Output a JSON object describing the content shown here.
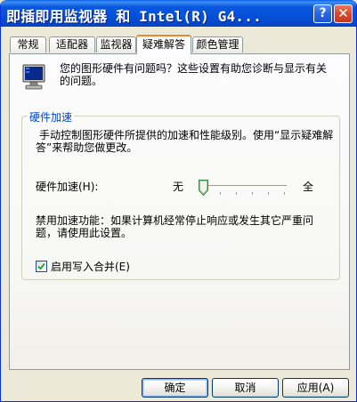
{
  "window": {
    "title": "即插即用监视器 和 Intel(R) G4..."
  },
  "titlebar": {
    "help_glyph": "?",
    "close_glyph": "✕"
  },
  "tabs": [
    {
      "label": "常规"
    },
    {
      "label": "适配器"
    },
    {
      "label": "监视器"
    },
    {
      "label": "疑难解答",
      "active": true
    },
    {
      "label": "颜色管理"
    }
  ],
  "intro": {
    "line1": "您的图形硬件有问题吗？这些设置有助您诊断与显示有关",
    "line2": "的问题。"
  },
  "hardware_acceleration": {
    "group_title": "硬件加速",
    "description_line1": "手动控制图形硬件所提供的加速和性能级别。使用“显示疑难解",
    "description_line2": "答”来帮助您做更改。",
    "slider_label": "硬件加速(H):",
    "slider_min_label": "无",
    "slider_max_label": "全",
    "slider_level": 0,
    "disable_note_line1": "禁用加速功能：如果计算机经常停止响应或发生其它严重问",
    "disable_note_line2": "题，请使用此设置。",
    "write_combining_label": "启用写入合并(E)",
    "write_combining_checked": true
  },
  "buttons": {
    "ok": "确定",
    "cancel": "取消",
    "apply": "应用(A)"
  },
  "colors": {
    "titlebar": "#0550d8",
    "active_tab_accent": "#e68b2c",
    "group_title": "#0046d5",
    "dialog_bg": "#ece9d8"
  }
}
